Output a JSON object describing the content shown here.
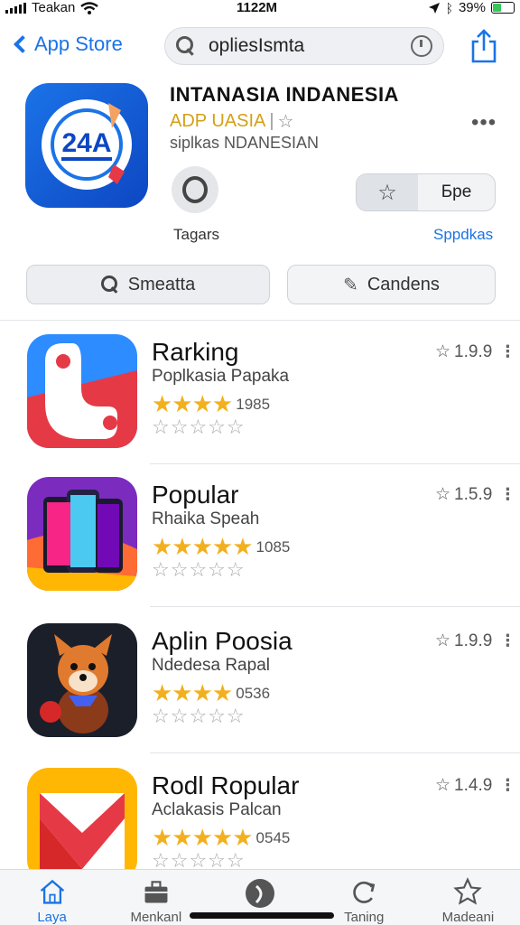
{
  "status_bar": {
    "carrier": "Teakan",
    "time": "1122M",
    "battery": "39%",
    "battery_level": 0.39
  },
  "nav": {
    "back_label": "App Store",
    "search_value": "opliesIsmta"
  },
  "app": {
    "icon_text": "24A",
    "title": "INTANASIA INDANESIA",
    "subtitle": "ADP UASIA",
    "developer": "siplkas NDANESIAN",
    "tag_label": "Tagars",
    "get_label": "Бре",
    "updates_label": "Sppdkas"
  },
  "actions": {
    "search_label": "Smeatta",
    "candens_label": "Candens"
  },
  "apps": [
    {
      "title": "Rarking",
      "subtitle": "Poplkasia Papaka",
      "rating": "1.9.9",
      "count": "1985",
      "stars": 3.5
    },
    {
      "title": "Popular",
      "subtitle": "Rhaika Speah",
      "rating": "1.5.9",
      "count": "1085",
      "stars": 4.5
    },
    {
      "title": "Aplin Poosia",
      "subtitle": "Ndedesa Rapal",
      "rating": "1.9.9",
      "count": "0536",
      "stars": 3.5
    },
    {
      "title": "Rodl Ropular",
      "subtitle": "Aclakasis Palcan",
      "rating": "1.4.9",
      "count": "0545",
      "stars": 4.5
    }
  ],
  "tabs": [
    {
      "label": "Laya",
      "icon": "home-icon",
      "active": true
    },
    {
      "label": "Menkanl",
      "icon": "briefcase-icon",
      "active": false
    },
    {
      "label": "",
      "icon": "compass-icon",
      "active": false
    },
    {
      "label": "Taning",
      "icon": "refresh-icon",
      "active": false
    },
    {
      "label": "Madeani",
      "icon": "star-icon",
      "active": false
    }
  ],
  "colors": {
    "accent": "#1a73e8",
    "star_gold": "#f2b01e",
    "brand_gold": "#d4a017"
  }
}
